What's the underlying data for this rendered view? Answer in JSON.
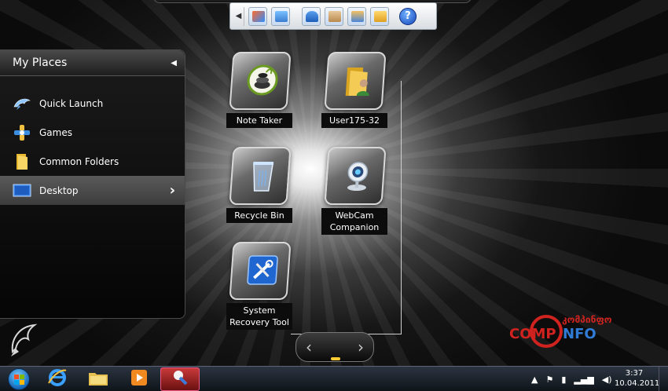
{
  "panel": {
    "title": "My Places",
    "items": [
      {
        "label": "Quick Launch",
        "icon": "dolphin-icon"
      },
      {
        "label": "Games",
        "icon": "games-icon"
      },
      {
        "label": "Common Folders",
        "icon": "folder-icon"
      },
      {
        "label": "Desktop",
        "icon": "desktop-icon",
        "selected": true
      }
    ]
  },
  "desktop": {
    "tiles": [
      {
        "label": "Note Taker",
        "icon": "note-taker-icon"
      },
      {
        "label": "User175-32",
        "icon": "user-folder-icon"
      },
      {
        "label": "Recycle Bin",
        "icon": "recycle-bin-icon"
      },
      {
        "label": "WebCam Companion",
        "icon": "webcam-icon"
      },
      {
        "label": "System Recovery Tool",
        "icon": "system-recovery-icon"
      }
    ]
  },
  "logo": {
    "georgian": "კომპინფო",
    "word_left": "COMP",
    "word_right": "NFO"
  },
  "taskbar": {
    "time": "3:37",
    "date": "10.04.2011"
  },
  "colors": {
    "logo_red": "#d0231f",
    "logo_blue": "#2f7bd6",
    "selected_item": "#4a4a4a"
  }
}
